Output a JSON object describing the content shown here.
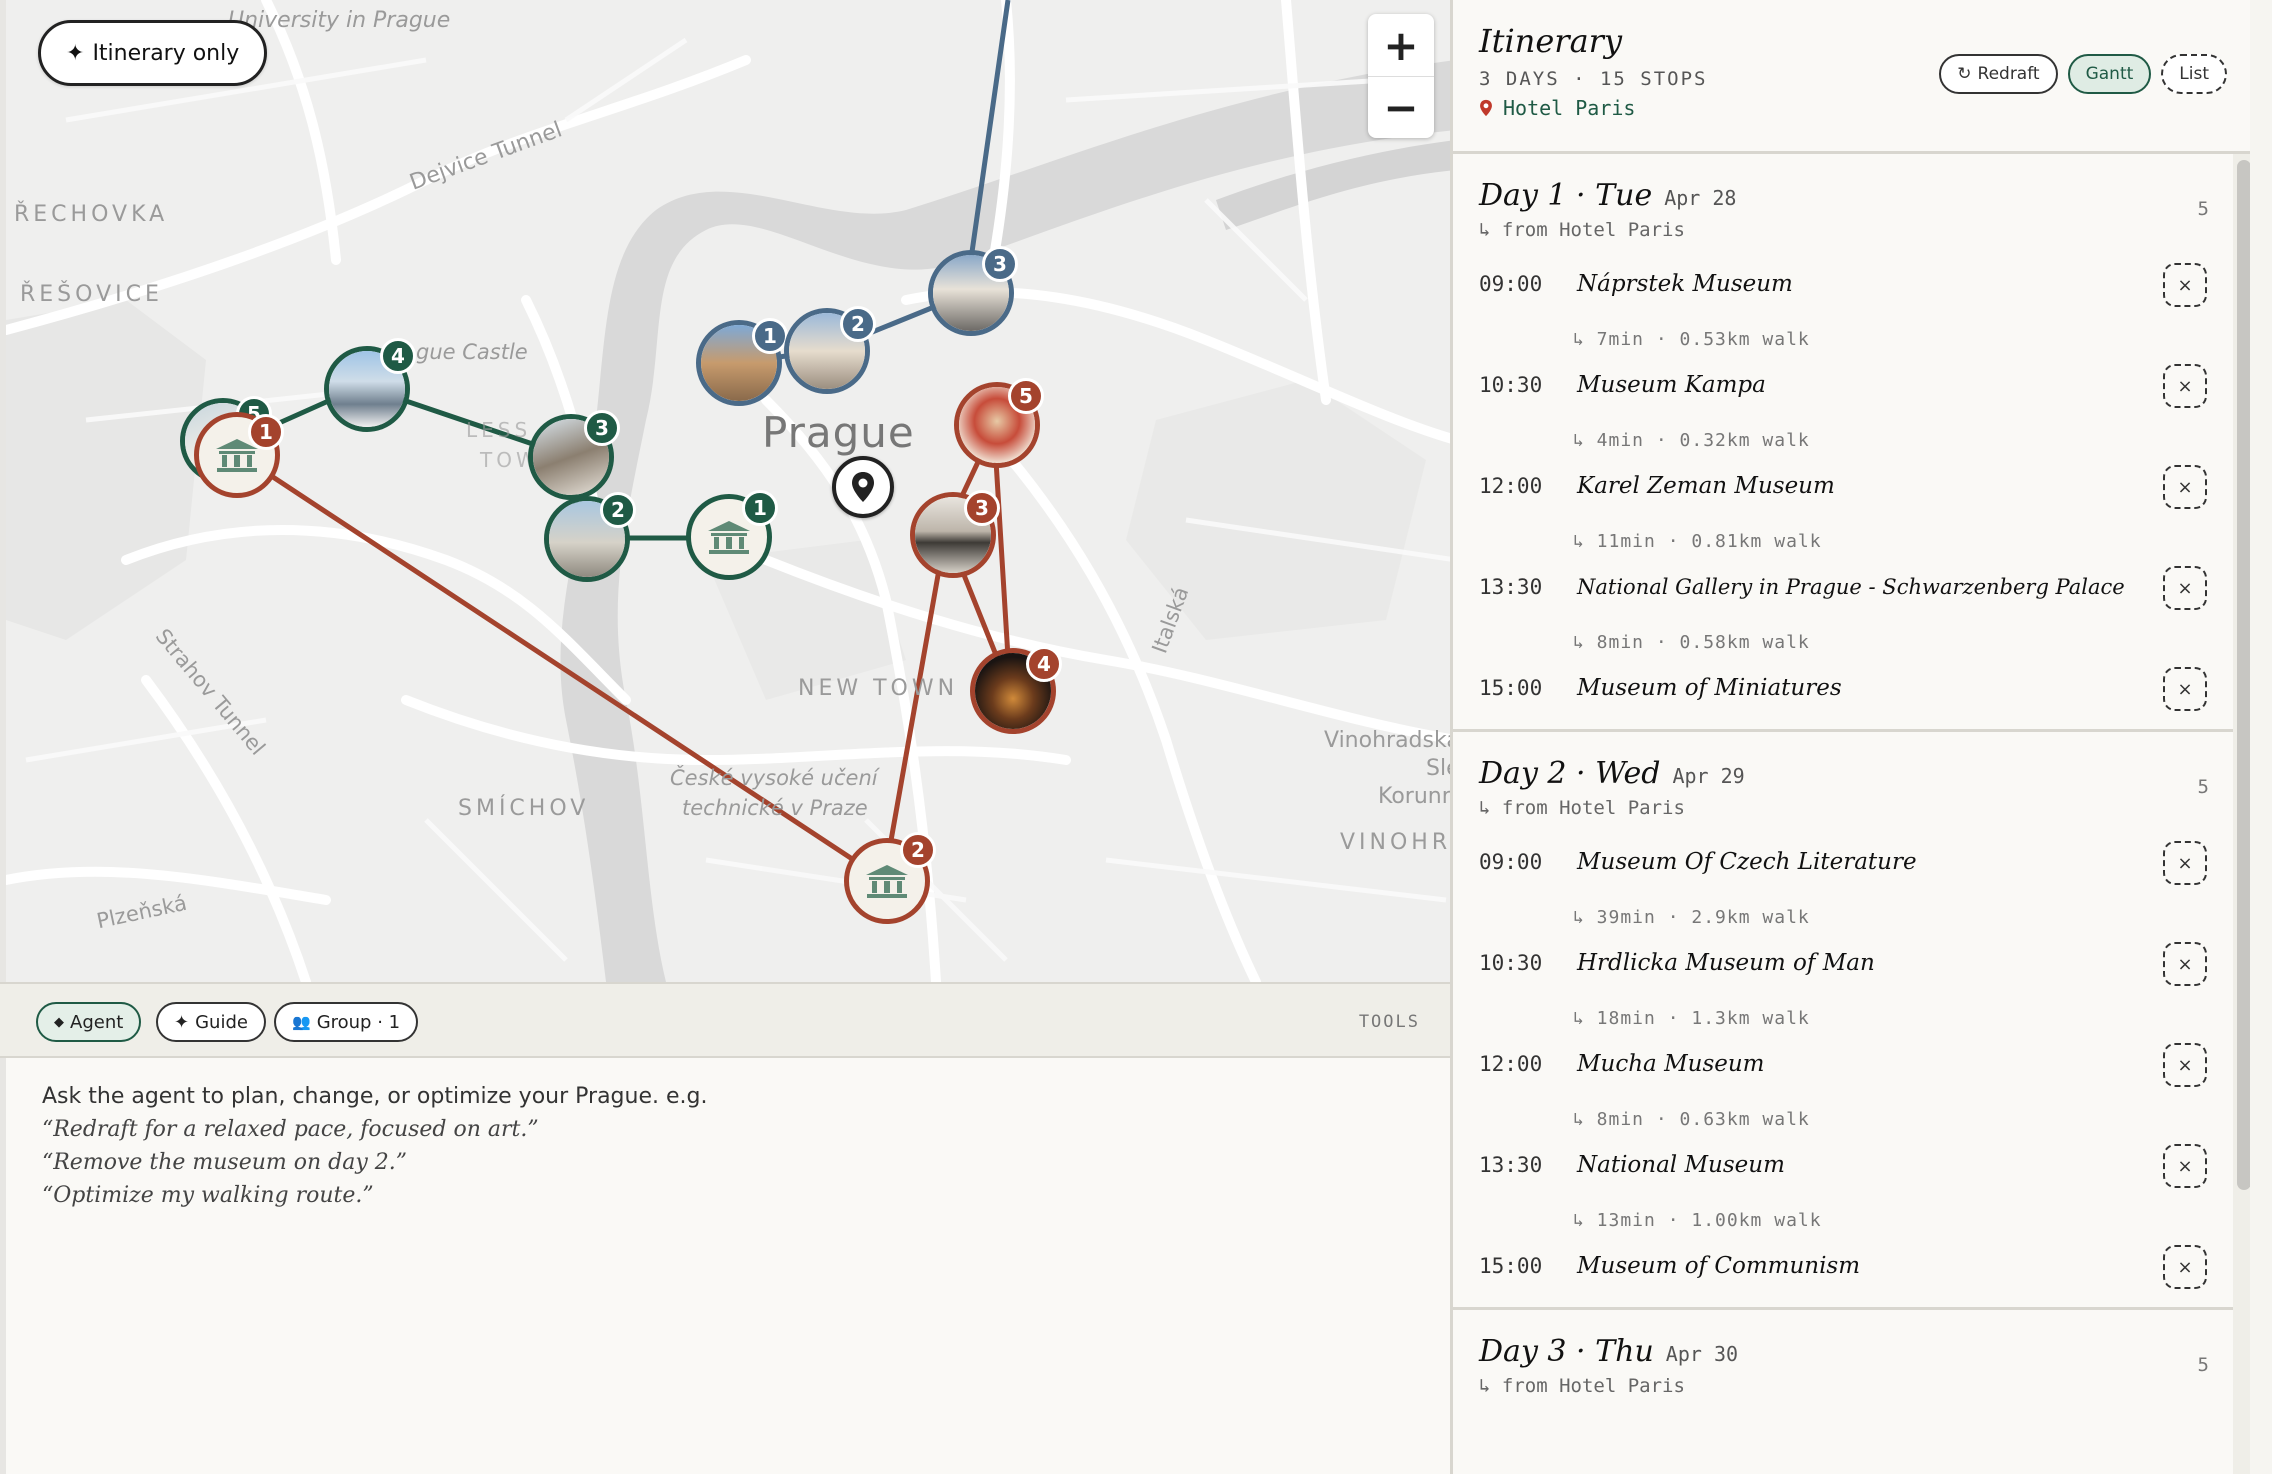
{
  "map": {
    "itinerary_only_label": "Itinerary only",
    "zoom_in": "+",
    "zoom_out": "−",
    "labels": {
      "university": "University in Prague",
      "dejvice_tunnel": "Dejvice Tunnel",
      "rechovka": "ŘECHOVKA",
      "resovice": "ŘEŠOVICE",
      "castle": "gue Castle",
      "less": "LESS",
      "tow": "TOW",
      "prague": "Prague",
      "new_town": "NEW TOWN",
      "italska": "Italská",
      "strahov": "Strahov Tunnel",
      "smichov": "SMÍCHOV",
      "ceske1": "České vysoké učení",
      "ceske2": "technické v Praze",
      "vinohradska": "Vinohradská",
      "sle": "Sle",
      "korunn": "Korunn",
      "vinohra": "VINOHRA",
      "plzenska": "Plzeňská"
    },
    "markers": {
      "green": [
        "1",
        "2",
        "3",
        "4",
        "5"
      ],
      "red": [
        "1",
        "2",
        "3",
        "4",
        "5"
      ],
      "blue": [
        "1",
        "2",
        "3"
      ]
    },
    "colors": {
      "day1": "#a4432d",
      "day2": "#1f5a45",
      "day3": "#4a6a88"
    },
    "hotel_pin_icon": "map-pin-icon"
  },
  "agent": {
    "tabs": [
      {
        "label": "Agent",
        "icon": "◆"
      },
      {
        "label": "Guide",
        "icon": "✦"
      },
      {
        "label": "Group · 1",
        "icon": "👥"
      }
    ],
    "tools_label": "TOOLS",
    "intro": "Ask the agent to plan, change, or optimize your Prague. e.g.",
    "examples": [
      "“Redraft for a relaxed pace, focused on art.”",
      "“Remove the museum on day 2.”",
      "“Optimize my walking route.”"
    ]
  },
  "sidebar": {
    "title": "Itinerary",
    "subtitle": "3 DAYS · 15 STOPS",
    "hotel": "Hotel Paris",
    "buttons": {
      "redraft": "Redraft",
      "gantt": "Gantt",
      "list": "List"
    },
    "days": [
      {
        "title": "Day 1 · Tue",
        "date": "Apr 28",
        "count": "5",
        "from": "↳ from Hotel Paris",
        "stops": [
          {
            "time": "09:00",
            "name": "Náprstek Museum",
            "walk": "↳ 7min · 0.53km walk"
          },
          {
            "time": "10:30",
            "name": "Museum Kampa",
            "walk": "↳ 4min · 0.32km walk"
          },
          {
            "time": "12:00",
            "name": "Karel Zeman Museum",
            "walk": "↳ 11min · 0.81km walk"
          },
          {
            "time": "13:30",
            "name": "National Gallery in Prague - Schwarzenberg Palace",
            "walk": "↳ 8min · 0.58km walk"
          },
          {
            "time": "15:00",
            "name": "Museum of Miniatures",
            "walk": ""
          }
        ]
      },
      {
        "title": "Day 2 · Wed",
        "date": "Apr 29",
        "count": "5",
        "from": "↳ from Hotel Paris",
        "stops": [
          {
            "time": "09:00",
            "name": "Museum Of Czech Literature",
            "walk": "↳ 39min · 2.9km walk"
          },
          {
            "time": "10:30",
            "name": "Hrdlicka Museum of Man",
            "walk": "↳ 18min · 1.3km walk"
          },
          {
            "time": "12:00",
            "name": "Mucha Museum",
            "walk": "↳ 8min · 0.63km walk"
          },
          {
            "time": "13:30",
            "name": "National Museum",
            "walk": "↳ 13min · 1.00km walk"
          },
          {
            "time": "15:00",
            "name": "Museum of Communism",
            "walk": ""
          }
        ]
      },
      {
        "title": "Day 3 · Thu",
        "date": "Apr 30",
        "count": "5",
        "from": "↳ from Hotel Paris",
        "stops": []
      }
    ]
  }
}
